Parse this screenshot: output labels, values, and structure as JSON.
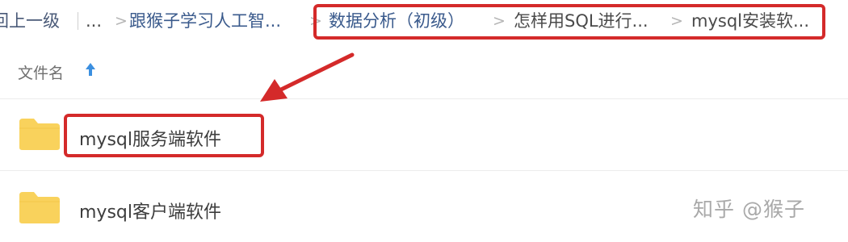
{
  "breadcrumb": {
    "up_label": "回上一级",
    "ellipsis": "...",
    "separator": ">",
    "items": [
      {
        "label": "跟猴子学习人工智..."
      },
      {
        "label": "数据分析（初级）"
      },
      {
        "label": "怎样用SQL进行..."
      },
      {
        "label": "mysql安装软..."
      }
    ]
  },
  "header": {
    "column_name": "文件名",
    "sort": "ascending"
  },
  "files": [
    {
      "name": "mysql服务端软件",
      "icon": "folder-icon",
      "highlighted": true
    },
    {
      "name": "mysql客户端软件",
      "icon": "folder-icon",
      "highlighted": false
    }
  ],
  "watermark": "知乎 @猴子",
  "colors": {
    "annotation": "#d42a2a",
    "folder": "#f9d25c",
    "sort_arrow": "#3b8fe0",
    "breadcrumb_link": "#3a5a8c"
  }
}
